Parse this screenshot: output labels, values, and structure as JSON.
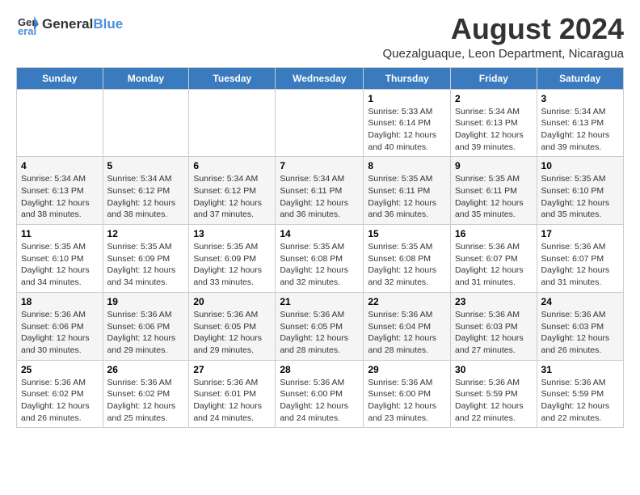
{
  "header": {
    "logo_general": "General",
    "logo_blue": "Blue",
    "title": "August 2024",
    "subtitle": "Quezalguaque, Leon Department, Nicaragua"
  },
  "days_of_week": [
    "Sunday",
    "Monday",
    "Tuesday",
    "Wednesday",
    "Thursday",
    "Friday",
    "Saturday"
  ],
  "weeks": [
    [
      {
        "day": "",
        "info": ""
      },
      {
        "day": "",
        "info": ""
      },
      {
        "day": "",
        "info": ""
      },
      {
        "day": "",
        "info": ""
      },
      {
        "day": "1",
        "info": "Sunrise: 5:33 AM\nSunset: 6:14 PM\nDaylight: 12 hours\nand 40 minutes."
      },
      {
        "day": "2",
        "info": "Sunrise: 5:34 AM\nSunset: 6:13 PM\nDaylight: 12 hours\nand 39 minutes."
      },
      {
        "day": "3",
        "info": "Sunrise: 5:34 AM\nSunset: 6:13 PM\nDaylight: 12 hours\nand 39 minutes."
      }
    ],
    [
      {
        "day": "4",
        "info": "Sunrise: 5:34 AM\nSunset: 6:13 PM\nDaylight: 12 hours\nand 38 minutes."
      },
      {
        "day": "5",
        "info": "Sunrise: 5:34 AM\nSunset: 6:12 PM\nDaylight: 12 hours\nand 38 minutes."
      },
      {
        "day": "6",
        "info": "Sunrise: 5:34 AM\nSunset: 6:12 PM\nDaylight: 12 hours\nand 37 minutes."
      },
      {
        "day": "7",
        "info": "Sunrise: 5:34 AM\nSunset: 6:11 PM\nDaylight: 12 hours\nand 36 minutes."
      },
      {
        "day": "8",
        "info": "Sunrise: 5:35 AM\nSunset: 6:11 PM\nDaylight: 12 hours\nand 36 minutes."
      },
      {
        "day": "9",
        "info": "Sunrise: 5:35 AM\nSunset: 6:11 PM\nDaylight: 12 hours\nand 35 minutes."
      },
      {
        "day": "10",
        "info": "Sunrise: 5:35 AM\nSunset: 6:10 PM\nDaylight: 12 hours\nand 35 minutes."
      }
    ],
    [
      {
        "day": "11",
        "info": "Sunrise: 5:35 AM\nSunset: 6:10 PM\nDaylight: 12 hours\nand 34 minutes."
      },
      {
        "day": "12",
        "info": "Sunrise: 5:35 AM\nSunset: 6:09 PM\nDaylight: 12 hours\nand 34 minutes."
      },
      {
        "day": "13",
        "info": "Sunrise: 5:35 AM\nSunset: 6:09 PM\nDaylight: 12 hours\nand 33 minutes."
      },
      {
        "day": "14",
        "info": "Sunrise: 5:35 AM\nSunset: 6:08 PM\nDaylight: 12 hours\nand 32 minutes."
      },
      {
        "day": "15",
        "info": "Sunrise: 5:35 AM\nSunset: 6:08 PM\nDaylight: 12 hours\nand 32 minutes."
      },
      {
        "day": "16",
        "info": "Sunrise: 5:36 AM\nSunset: 6:07 PM\nDaylight: 12 hours\nand 31 minutes."
      },
      {
        "day": "17",
        "info": "Sunrise: 5:36 AM\nSunset: 6:07 PM\nDaylight: 12 hours\nand 31 minutes."
      }
    ],
    [
      {
        "day": "18",
        "info": "Sunrise: 5:36 AM\nSunset: 6:06 PM\nDaylight: 12 hours\nand 30 minutes."
      },
      {
        "day": "19",
        "info": "Sunrise: 5:36 AM\nSunset: 6:06 PM\nDaylight: 12 hours\nand 29 minutes."
      },
      {
        "day": "20",
        "info": "Sunrise: 5:36 AM\nSunset: 6:05 PM\nDaylight: 12 hours\nand 29 minutes."
      },
      {
        "day": "21",
        "info": "Sunrise: 5:36 AM\nSunset: 6:05 PM\nDaylight: 12 hours\nand 28 minutes."
      },
      {
        "day": "22",
        "info": "Sunrise: 5:36 AM\nSunset: 6:04 PM\nDaylight: 12 hours\nand 28 minutes."
      },
      {
        "day": "23",
        "info": "Sunrise: 5:36 AM\nSunset: 6:03 PM\nDaylight: 12 hours\nand 27 minutes."
      },
      {
        "day": "24",
        "info": "Sunrise: 5:36 AM\nSunset: 6:03 PM\nDaylight: 12 hours\nand 26 minutes."
      }
    ],
    [
      {
        "day": "25",
        "info": "Sunrise: 5:36 AM\nSunset: 6:02 PM\nDaylight: 12 hours\nand 26 minutes."
      },
      {
        "day": "26",
        "info": "Sunrise: 5:36 AM\nSunset: 6:02 PM\nDaylight: 12 hours\nand 25 minutes."
      },
      {
        "day": "27",
        "info": "Sunrise: 5:36 AM\nSunset: 6:01 PM\nDaylight: 12 hours\nand 24 minutes."
      },
      {
        "day": "28",
        "info": "Sunrise: 5:36 AM\nSunset: 6:00 PM\nDaylight: 12 hours\nand 24 minutes."
      },
      {
        "day": "29",
        "info": "Sunrise: 5:36 AM\nSunset: 6:00 PM\nDaylight: 12 hours\nand 23 minutes."
      },
      {
        "day": "30",
        "info": "Sunrise: 5:36 AM\nSunset: 5:59 PM\nDaylight: 12 hours\nand 22 minutes."
      },
      {
        "day": "31",
        "info": "Sunrise: 5:36 AM\nSunset: 5:59 PM\nDaylight: 12 hours\nand 22 minutes."
      }
    ]
  ]
}
